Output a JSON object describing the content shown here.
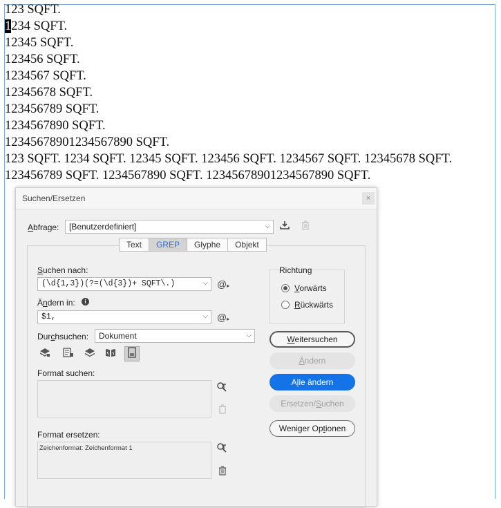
{
  "document": {
    "lines": [
      "123 SQFT.",
      "1234 SQFT.",
      "12345 SQFT.",
      "123456 SQFT.",
      "1234567 SQFT.",
      "12345678 SQFT.",
      "123456789 SQFT.",
      "1234567890 SQFT.",
      "12345678901234567890 SQFT.",
      "123 SQFT. 1234 SQFT. 12345 SQFT. 123456 SQFT. 1234567 SQFT. 12345678 SQFT.",
      "123456789 SQFT. 1234567890 SQFT. 12345678901234567890 SQFT."
    ],
    "cursor_char": "1",
    "cursor_line_rest": "234 SQFT."
  },
  "dialog": {
    "title": "Suchen/Ersetzen",
    "close_glyph": "×",
    "query": {
      "label_u": "A",
      "label_rest": "bfrage:",
      "value": "[Benutzerdefiniert]"
    },
    "tabs": [
      "Text",
      "GREP",
      "Glyphe",
      "Objekt"
    ],
    "search": {
      "label_u": "S",
      "label_rest": "uchen nach:",
      "value": "(\\d{1,3})(?=(\\d{3})+ SQFT\\.)"
    },
    "replace": {
      "label_pre": "Ä",
      "label_u": "n",
      "label_rest": "dern in:",
      "info_glyph": "i",
      "value": "$1,"
    },
    "scope": {
      "label_pre": "Dur",
      "label_u": "c",
      "label_rest": "hsuchen:",
      "value": "Dokument"
    },
    "direction": {
      "legend": "Richtung",
      "forward_u": "V",
      "forward_rest": "orwärts",
      "backward_u": "R",
      "backward_rest": "ückwärts",
      "selected": "Vorwärts"
    },
    "format_search": {
      "label": "Format suchen:",
      "text": ""
    },
    "format_replace": {
      "label": "Format ersetzen:",
      "text": "Zeichenformat: Zeichenformat 1"
    },
    "buttons": {
      "find_next_u": "W",
      "find_next_rest": "eitersuchen",
      "change_u": "Ä",
      "change_rest": "ndern",
      "change_all_pre": "A",
      "change_all_u": "l",
      "change_all_rest": "le ändern",
      "change_find_pre": "Ersetzen/",
      "change_find_u": "S",
      "change_find_rest": "uchen",
      "fewer_pre": "Weniger Op",
      "fewer_u": "t",
      "fewer_rest": "ionen"
    },
    "icons": {
      "save_query": "save-query-icon",
      "delete_query": "trash-icon",
      "special_chars": "at-icon"
    },
    "colors": {
      "accent": "#1473e6",
      "active_tab_text": "#2e6fd3"
    }
  }
}
